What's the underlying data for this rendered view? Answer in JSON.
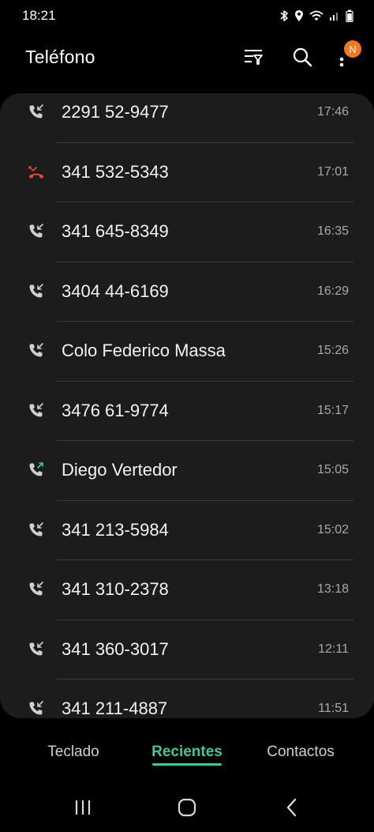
{
  "status_bar": {
    "time": "18:21",
    "icons": [
      "bluetooth-icon",
      "location-icon",
      "wifi-icon",
      "signal-icon",
      "battery-icon"
    ]
  },
  "header": {
    "title": "Teléfono",
    "filter_icon": "filter-icon",
    "search_icon": "search-icon",
    "more_icon": "more-vertical-icon",
    "badge": "N"
  },
  "calls": [
    {
      "name": "2291 52-9477",
      "time": "17:46",
      "type": "incoming"
    },
    {
      "name": "341 532-5343",
      "time": "17:01",
      "type": "missed"
    },
    {
      "name": "341 645-8349",
      "time": "16:35",
      "type": "incoming"
    },
    {
      "name": "3404 44-6169",
      "time": "16:29",
      "type": "incoming"
    },
    {
      "name": "Colo Federico Massa",
      "time": "15:26",
      "type": "incoming"
    },
    {
      "name": "3476 61-9774",
      "time": "15:17",
      "type": "incoming"
    },
    {
      "name": "Diego Vertedor",
      "time": "15:05",
      "type": "outgoing"
    },
    {
      "name": "341 213-5984",
      "time": "15:02",
      "type": "incoming"
    },
    {
      "name": "341 310-2378",
      "time": "13:18",
      "type": "incoming"
    },
    {
      "name": "341 360-3017",
      "time": "12:11",
      "type": "incoming"
    },
    {
      "name": "341 211-4887",
      "time": "11:51",
      "type": "incoming"
    }
  ],
  "tabs": [
    {
      "label": "Teclado",
      "active": false
    },
    {
      "label": "Recientes",
      "active": true
    },
    {
      "label": "Contactos",
      "active": false
    }
  ],
  "colors": {
    "accent": "#3fc996",
    "missed": "#e8452f",
    "outgoing": "#3fc996",
    "badge": "#f1781f",
    "card": "#1c1c1c"
  },
  "nav": [
    "recent-apps-icon",
    "home-icon",
    "back-icon"
  ]
}
